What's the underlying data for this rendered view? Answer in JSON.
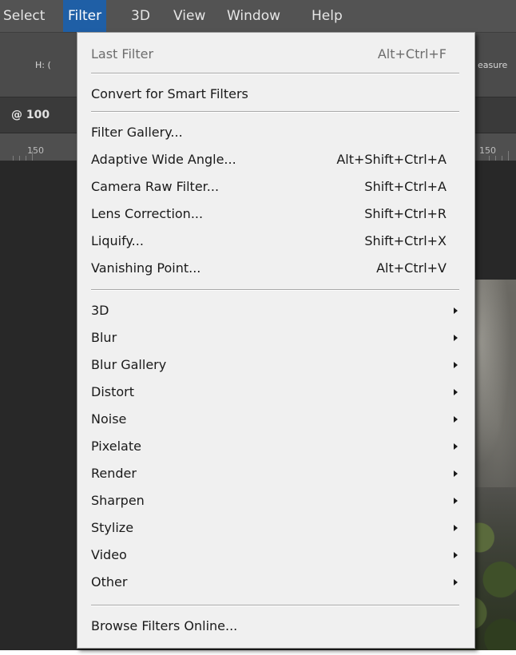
{
  "menubar": {
    "items": [
      {
        "label": "Select"
      },
      {
        "label": "Filter"
      },
      {
        "label": "3D"
      },
      {
        "label": "View"
      },
      {
        "label": "Window"
      },
      {
        "label": "Help"
      }
    ],
    "active_index": 1
  },
  "options_bar": {
    "left_text": "H: (",
    "right_text": "easure"
  },
  "document_tab": {
    "label": "@ 100"
  },
  "ruler": {
    "left_label": "150",
    "right_label": "150"
  },
  "filter_menu": {
    "last_filter": {
      "label": "Last Filter",
      "shortcut": "Alt+Ctrl+F"
    },
    "convert": {
      "label": "Convert for Smart Filters"
    },
    "gallery_group": [
      {
        "label": "Filter Gallery...",
        "shortcut": ""
      },
      {
        "label": "Adaptive Wide Angle...",
        "shortcut": "Alt+Shift+Ctrl+A"
      },
      {
        "label": "Camera Raw Filter...",
        "shortcut": "Shift+Ctrl+A"
      },
      {
        "label": "Lens Correction...",
        "shortcut": "Shift+Ctrl+R"
      },
      {
        "label": "Liquify...",
        "shortcut": "Shift+Ctrl+X"
      },
      {
        "label": "Vanishing Point...",
        "shortcut": "Alt+Ctrl+V"
      }
    ],
    "submenus": [
      {
        "label": "3D"
      },
      {
        "label": "Blur"
      },
      {
        "label": "Blur Gallery"
      },
      {
        "label": "Distort"
      },
      {
        "label": "Noise"
      },
      {
        "label": "Pixelate"
      },
      {
        "label": "Render"
      },
      {
        "label": "Sharpen"
      },
      {
        "label": "Stylize"
      },
      {
        "label": "Video"
      },
      {
        "label": "Other"
      }
    ],
    "browse": {
      "label": "Browse Filters Online..."
    }
  },
  "colors": {
    "menu_background": "#f0f0f0",
    "menubar_background": "#535353",
    "active_menu": "#1f5fa6",
    "disabled_text": "#6d6d6d"
  }
}
